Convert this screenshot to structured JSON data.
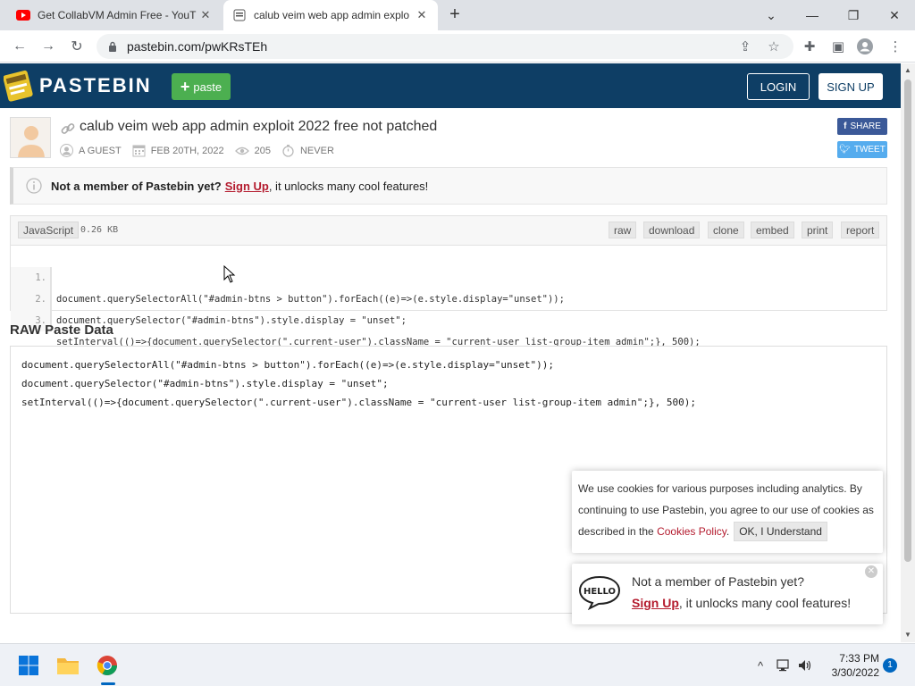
{
  "browser": {
    "tabs": [
      {
        "title": "Get CollabVM Admin Free - YouT",
        "active": false
      },
      {
        "title": "calub veim web app admin explo",
        "active": true
      }
    ],
    "url": "pastebin.com/pwKRsTEh"
  },
  "header": {
    "brand": "PASTEBIN",
    "paste_label": "paste",
    "login_label": "LOGIN",
    "signup_label": "SIGN UP"
  },
  "post": {
    "title": "calub veim web app admin exploit 2022 free not patched",
    "author": "A GUEST",
    "date": "FEB 20TH, 2022",
    "views": "205",
    "expiry": "NEVER",
    "share_label": "SHARE",
    "tweet_label": "TWEET"
  },
  "notice": {
    "bold": "Not a member of Pastebin yet?",
    "link": "Sign Up",
    "rest": ", it unlocks many cool features!"
  },
  "code": {
    "language": "JavaScript",
    "size": "0.26 KB",
    "actions": [
      "raw",
      "download",
      "clone",
      "embed",
      "print",
      "report"
    ],
    "lines": [
      {
        "num": "1.",
        "text": "document.querySelectorAll(\"#admin-btns > button\").forEach((e)=>(e.style.display=\"unset\"));"
      },
      {
        "num": "2.",
        "text": "document.querySelector(\"#admin-btns\").style.display = \"unset\";"
      },
      {
        "num": "3.",
        "text": "setInterval(()=>{document.querySelector(\".current-user\").className = \"current-user list-group-item admin\";}, 500);"
      }
    ]
  },
  "raw": {
    "title": "RAW Paste Data",
    "lines": [
      "document.querySelectorAll(\"#admin-btns > button\").forEach((e)=>(e.style.display=\"unset\"));",
      "document.querySelector(\"#admin-btns\").style.display = \"unset\";",
      "setInterval(()=>{document.querySelector(\".current-user\").className = \"current-user list-group-item admin\";}, 500);"
    ]
  },
  "cookie": {
    "text": "We use cookies for various purposes including analytics. By continuing to use Pastebin, you agree to our use of cookies as described in the ",
    "link": "Cookies Policy",
    "after": ".",
    "ok_label": "OK, I Understand"
  },
  "hello": {
    "line1": "Not a member of Pastebin yet?",
    "link": "Sign Up",
    "rest": ", it unlocks many cool features!"
  },
  "taskbar": {
    "time": "7:33 PM",
    "date": "3/30/2022",
    "notifications": "1"
  },
  "colors": {
    "header_bg": "#0e3e65",
    "paste_green": "#4caf50",
    "link_red": "#b41b2e",
    "facebook": "#3b5998",
    "twitter": "#55acee"
  }
}
